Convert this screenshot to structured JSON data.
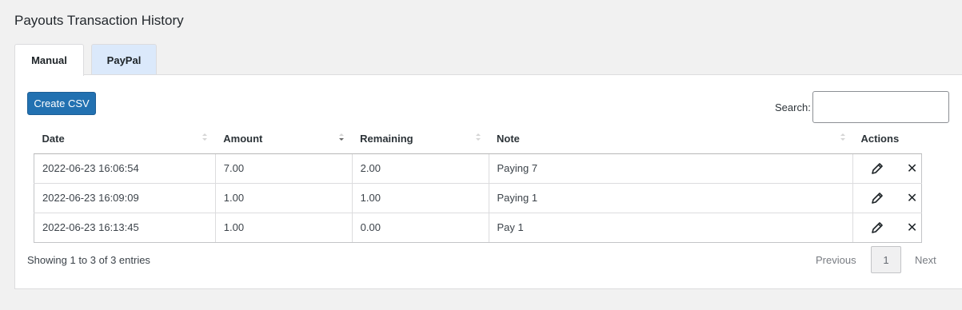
{
  "page": {
    "title": "Payouts Transaction History"
  },
  "tabs": [
    {
      "label": "Manual",
      "active": true
    },
    {
      "label": "PayPal",
      "active": false
    }
  ],
  "toolbar": {
    "create_csv_label": "Create CSV",
    "search_label": "Search:",
    "search_value": ""
  },
  "table": {
    "columns": [
      "Date",
      "Amount",
      "Remaining",
      "Note",
      "Actions"
    ],
    "rows": [
      {
        "date": "2022-06-23 16:06:54",
        "amount": "7.00",
        "remaining": "2.00",
        "note": "Paying 7"
      },
      {
        "date": "2022-06-23 16:09:09",
        "amount": "1.00",
        "remaining": "1.00",
        "note": "Paying 1"
      },
      {
        "date": "2022-06-23 16:13:45",
        "amount": "1.00",
        "remaining": "0.00",
        "note": "Pay 1"
      }
    ]
  },
  "footer": {
    "info": "Showing 1 to 3 of 3 entries",
    "previous_label": "Previous",
    "current_page": "1",
    "next_label": "Next"
  },
  "icons": {
    "edit": "pencil-icon",
    "delete": "close-icon"
  },
  "colors": {
    "primary": "#2271b1",
    "tab_inactive": "#dbe9fb"
  }
}
